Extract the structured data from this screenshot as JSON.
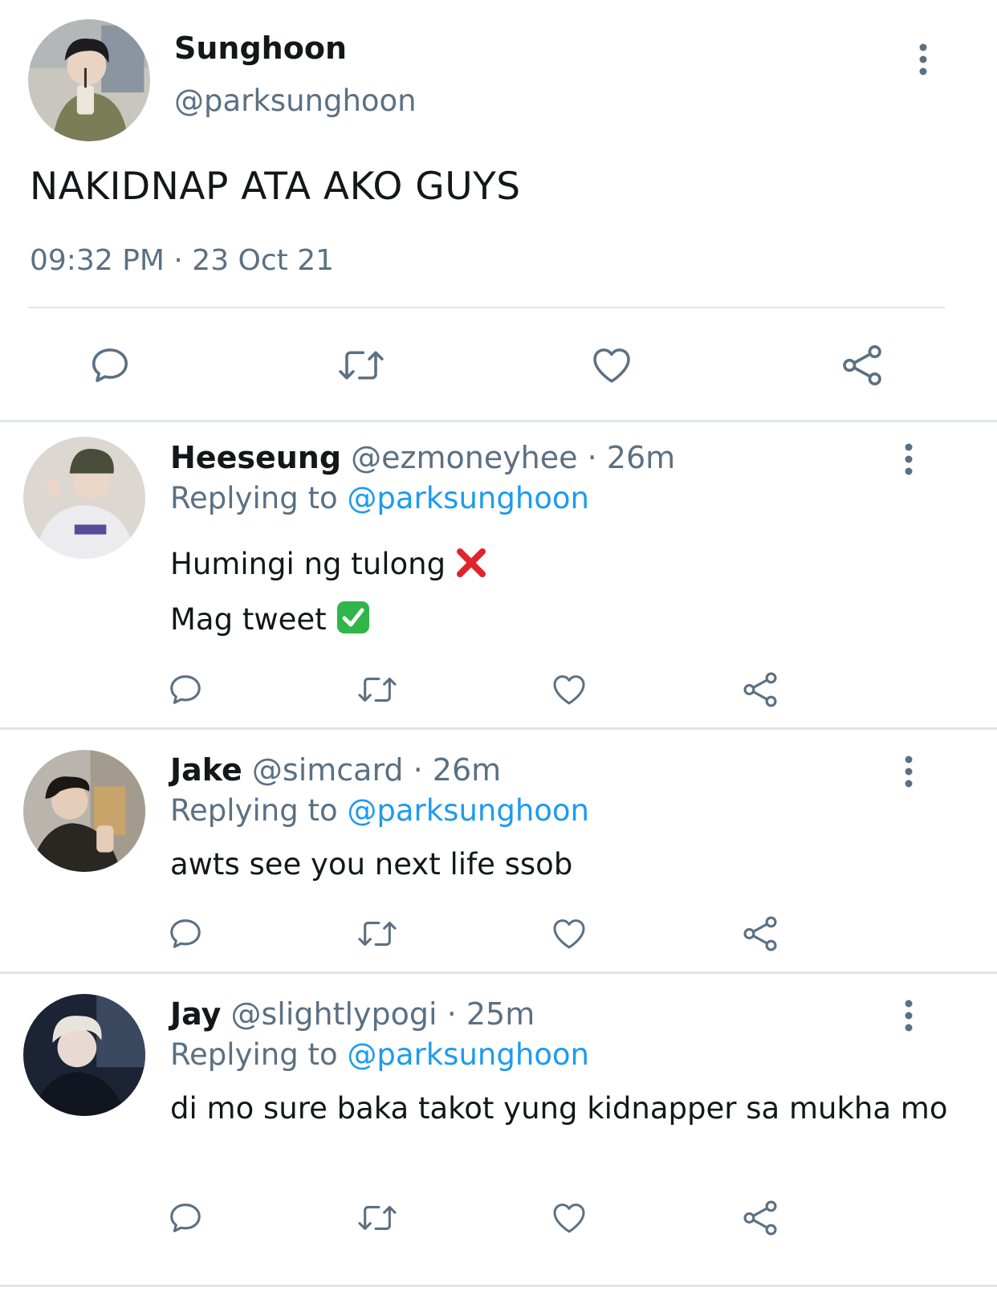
{
  "tweet": {
    "name": "Sunghoon",
    "handle": "@parksunghoon",
    "text": "NAKIDNAP ATA AKO GUYS",
    "timestamp": "09:32 PM · 23 Oct 21",
    "icons": {
      "more": "more-vertical-icon",
      "reply": "reply-icon",
      "retweet": "retweet-icon",
      "like": "heart-icon",
      "share": "share-icon"
    }
  },
  "replies": [
    {
      "name": "Heeseung",
      "handle": "@ezmoneyhee",
      "time": "· 26m",
      "replying_label": "Replying to",
      "replying_to": "@parksunghoon",
      "lines": [
        "Humingi ng tulong",
        "Mag tweet"
      ],
      "emojis": [
        "cross-mark-emoji",
        "check-mark-button-emoji"
      ]
    },
    {
      "name": "Jake",
      "handle": "@simcard",
      "time": "· 26m",
      "replying_label": "Replying to",
      "replying_to": "@parksunghoon",
      "text": "awts see you next life ssob"
    },
    {
      "name": "Jay",
      "handle": "@slightlypogi",
      "time": "· 25m",
      "replying_label": "Replying to",
      "replying_to": "@parksunghoon",
      "text": "di mo sure baka takot yung kidnapper sa mukha mo"
    }
  ],
  "colors": {
    "text": "#14171a",
    "muted": "#5b7083",
    "link": "#1d9bf0",
    "divider": "#e1e4e8",
    "cross": "#e0242c",
    "check": "#2fb54a"
  }
}
